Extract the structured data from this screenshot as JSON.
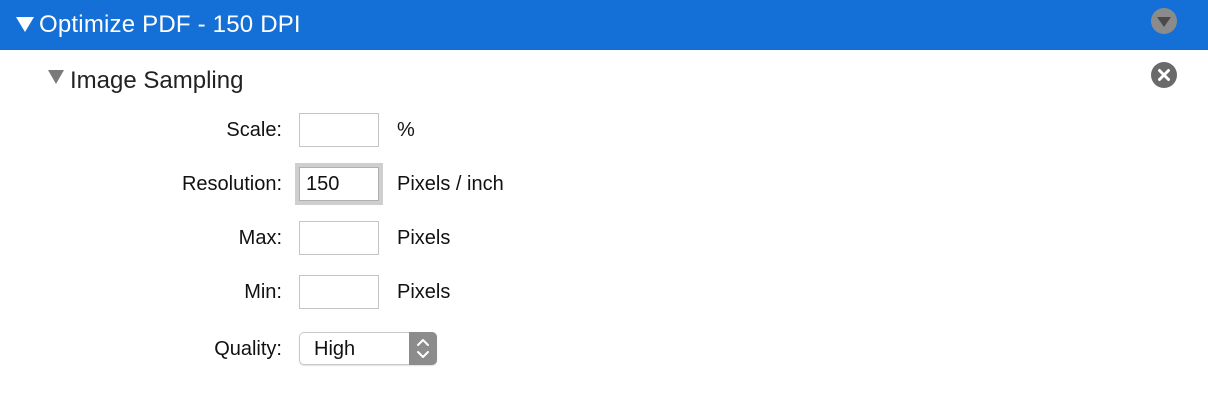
{
  "header": {
    "title": "Optimize PDF - 150 DPI",
    "background_color": "#1470d6",
    "disclosure_icon": "disclosure-triangle-expanded",
    "menu_icon": "circle-triangle-down"
  },
  "section": {
    "title": "Image Sampling",
    "disclosure_icon": "disclosure-triangle-expanded",
    "remove_icon": "circle-x"
  },
  "form": {
    "scale": {
      "label": "Scale:",
      "value": "",
      "unit": "%"
    },
    "resolution": {
      "label": "Resolution:",
      "value": "150",
      "unit": "Pixels / inch"
    },
    "max": {
      "label": "Max:",
      "value": "",
      "unit": "Pixels"
    },
    "min": {
      "label": "Min:",
      "value": "",
      "unit": "Pixels"
    },
    "quality": {
      "label": "Quality:",
      "selected": "High",
      "stepper_icon": "up-down-chevron"
    }
  }
}
